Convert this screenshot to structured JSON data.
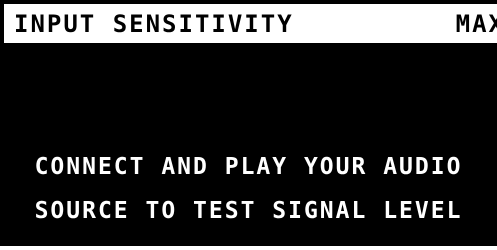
{
  "header": {
    "title": "INPUT SENSITIVITY",
    "value": "MAX"
  },
  "message": {
    "line1": "CONNECT AND PLAY YOUR AUDIO",
    "line2": "SOURCE TO TEST SIGNAL LEVEL"
  },
  "colors": {
    "background": "#000000",
    "header_background": "#ffffff",
    "text_on_dark": "#ffffff",
    "text_on_light": "#000000"
  }
}
